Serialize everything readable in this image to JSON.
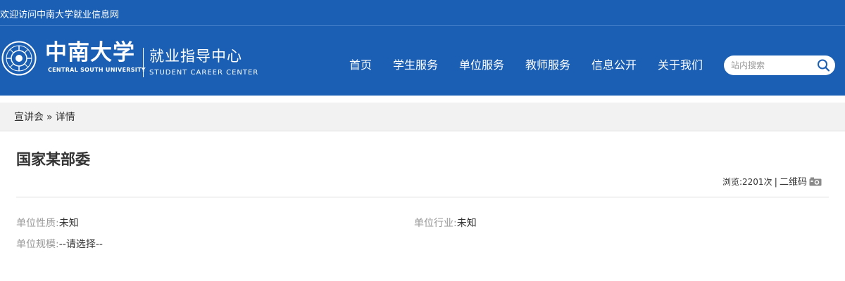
{
  "topbar": {
    "welcome": "欢迎访问中南大学就业信息网"
  },
  "brand": {
    "university_cn": "中南大学",
    "university_en": "CENTRAL SOUTH UNIVERSITY",
    "center_cn": "就业指导中心",
    "center_en": "STUDENT CAREER CENTER",
    "primary_color": "#1a5fb4"
  },
  "nav": {
    "items": [
      {
        "label": "首页"
      },
      {
        "label": "学生服务"
      },
      {
        "label": "单位服务"
      },
      {
        "label": "教师服务"
      },
      {
        "label": "信息公开"
      },
      {
        "label": "关于我们"
      }
    ]
  },
  "search": {
    "placeholder": "站内搜索",
    "value": "",
    "icon": "search-icon"
  },
  "breadcrumb": {
    "section": "宣讲会",
    "separator": "»",
    "current": "详情"
  },
  "article": {
    "title": "国家某部委",
    "views_label": "浏览:",
    "views_count": "2201",
    "views_unit": "次",
    "separator": "|",
    "qrcode_label": "二维码",
    "qrcode_icon": "camera-icon"
  },
  "details": {
    "nature_label": "单位性质:",
    "nature_value": "未知",
    "industry_label": "单位行业:",
    "industry_value": "未知",
    "scale_label": "单位规模:",
    "scale_value": "--请选择--"
  }
}
